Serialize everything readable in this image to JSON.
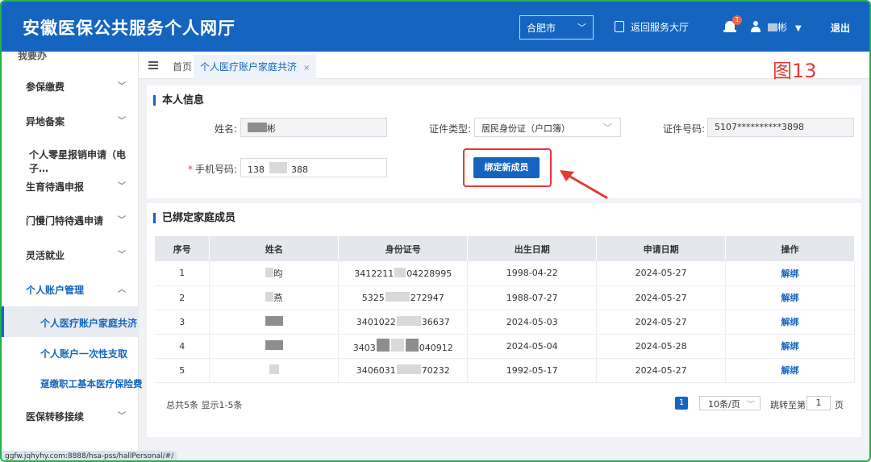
{
  "header": {
    "title": "安徽医保公共服务个人网厅",
    "city_select": "合肥市",
    "back_link": "返回服务大厅",
    "notification_count": "1",
    "user_name": "彬",
    "logout": "退出"
  },
  "sidebar": {
    "partial_top": "我要办",
    "items": [
      {
        "label": "参保缴费"
      },
      {
        "label": "异地备案"
      },
      {
        "label": "个人零星报销申请（电子…"
      },
      {
        "label": "生育待遇申报"
      },
      {
        "label": "门慢门特待遇申请"
      },
      {
        "label": "灵活就业"
      },
      {
        "label": "个人账户管理"
      },
      {
        "label": "医保转移接续"
      }
    ],
    "subitems": [
      {
        "label": "个人医疗账户家庭共济"
      },
      {
        "label": "个人账户一次性支取"
      },
      {
        "label": "趸缴职工基本医疗保险费"
      }
    ]
  },
  "tabs": {
    "home": "首页",
    "active": "个人医疗账户家庭共济",
    "close": "×"
  },
  "annotation": "图13",
  "personal_info": {
    "heading": "本人信息",
    "name_label": "姓名:",
    "name_value": "彬",
    "id_type_label": "证件类型:",
    "id_type_value": "居民身份证（户口簿）",
    "id_no_label": "证件号码:",
    "id_no_value": "5107**********3898",
    "phone_label": "手机号码:",
    "phone_prefix": "138",
    "phone_suffix": "388",
    "bind_button": "绑定新成员"
  },
  "family": {
    "heading": "已绑定家庭成员",
    "columns": [
      "序号",
      "姓名",
      "身份证号",
      "出生日期",
      "申请日期",
      "操作"
    ],
    "rows": [
      {
        "no": "1",
        "name": "昀",
        "id_a": "3412211",
        "id_b": "04228995",
        "birth": "1998-04-22",
        "apply": "2024-05-27",
        "op": "解绑"
      },
      {
        "no": "2",
        "name": "燕",
        "id_a": "5325",
        "id_b": "272947",
        "birth": "1988-07-27",
        "apply": "2024-05-27",
        "op": "解绑"
      },
      {
        "no": "3",
        "name": "",
        "id_a": "3401022",
        "id_b": "36637",
        "birth": "2024-05-03",
        "apply": "2024-05-27",
        "op": "解绑"
      },
      {
        "no": "4",
        "name": "",
        "id_a": "3403",
        "id_b": "040912",
        "birth": "2024-05-04",
        "apply": "2024-05-28",
        "op": "解绑"
      },
      {
        "no": "5",
        "name": "",
        "id_a": "3406031",
        "id_b": "70232",
        "birth": "1992-05-17",
        "apply": "2024-05-27",
        "op": "解绑"
      }
    ]
  },
  "pager": {
    "total": "总共5条 显示1-5条",
    "current": "1",
    "page_size": "10条/页",
    "jump_label": "跳转至第",
    "jump_value": "1",
    "page_unit": "页"
  },
  "statusbar": "ggfw.jqhyhy.com:8888/hsa-pss/hallPersonal/#/"
}
